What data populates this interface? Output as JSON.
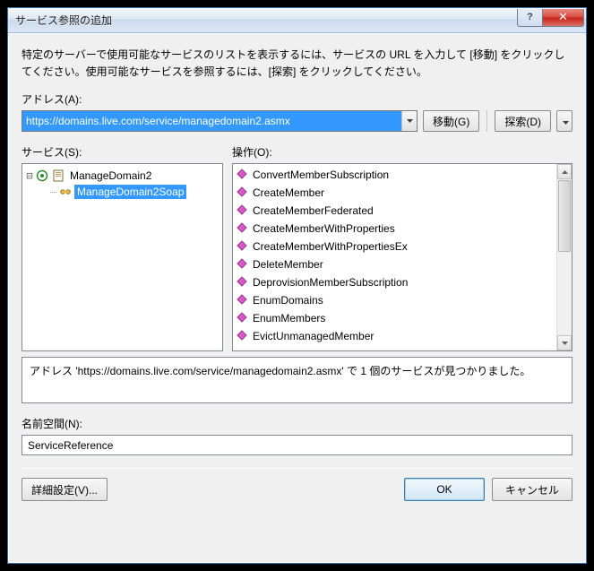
{
  "title": "サービス参照の追加",
  "instructions": "特定のサーバーで使用可能なサービスのリストを表示するには、サービスの URL を入力して [移動] をクリックしてください。使用可能なサービスを参照するには、[探索] をクリックしてください。",
  "address": {
    "label": "アドレス(A):",
    "value": "https://domains.live.com/service/managedomain2.asmx",
    "go": "移動(G)",
    "discover": "探索(D)"
  },
  "services": {
    "label": "サービス(S):",
    "root": "ManageDomain2",
    "child": "ManageDomain2Soap"
  },
  "operations": {
    "label": "操作(O):",
    "items": [
      "ConvertMemberSubscription",
      "CreateMember",
      "CreateMemberFederated",
      "CreateMemberWithProperties",
      "CreateMemberWithPropertiesEx",
      "DeleteMember",
      "DeprovisionMemberSubscription",
      "EnumDomains",
      "EnumMembers",
      "EvictUnmanagedMember"
    ]
  },
  "status": "アドレス 'https://domains.live.com/service/managedomain2.asmx' で 1 個のサービスが見つかりました。",
  "namespace": {
    "label": "名前空間(N):",
    "value": "ServiceReference"
  },
  "footer": {
    "advanced": "詳細設定(V)...",
    "ok": "OK",
    "cancel": "キャンセル"
  }
}
